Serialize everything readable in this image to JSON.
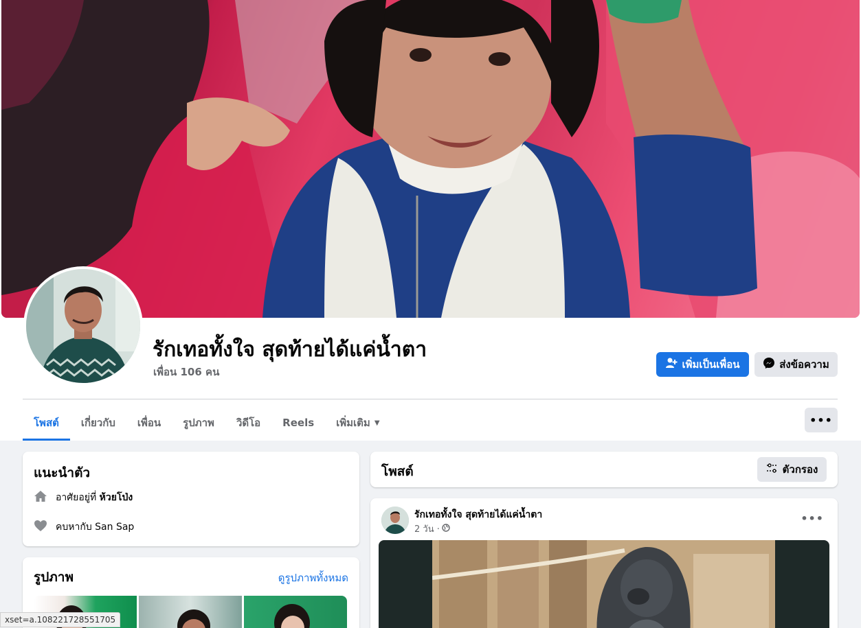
{
  "profile": {
    "name": "รักเทอทั้งใจ สุดท้ายได้แค่น้ำตา",
    "friends": "เพื่อน 106 คน"
  },
  "actions": {
    "add_friend": "เพิ่มเป็นเพื่อน",
    "message": "ส่งข้อความ",
    "more": "•••"
  },
  "tabs": [
    {
      "label": "โพสต์",
      "active": true
    },
    {
      "label": "เกี่ยวกับ",
      "active": false
    },
    {
      "label": "เพื่อน",
      "active": false
    },
    {
      "label": "รูปภาพ",
      "active": false
    },
    {
      "label": "วิดีโอ",
      "active": false
    },
    {
      "label": "Reels",
      "active": false
    },
    {
      "label": "เพิ่มเติม",
      "active": false
    }
  ],
  "intro": {
    "title": "แนะนำตัว",
    "lives_prefix": "อาศัยอยู่ที่",
    "lives_place": "ห้วยโป่ง",
    "relationship": "คบหากับ San Sap"
  },
  "photos": {
    "title": "รูปภาพ",
    "see_all": "ดูรูปภาพทั้งหมด"
  },
  "posts": {
    "title": "โพสต์",
    "filter": "ตัวกรอง"
  },
  "post": {
    "author": "รักเทอทั้งใจ สุดท้ายได้แค่น้ำตา",
    "time": "2 วัน ·",
    "more": "•••"
  },
  "status_bar": {
    "url": "xset=a.108221728551705"
  },
  "colors": {
    "accent": "#1b74e4",
    "background": "#f0f2f5",
    "secondary_button": "#e4e6eb"
  }
}
